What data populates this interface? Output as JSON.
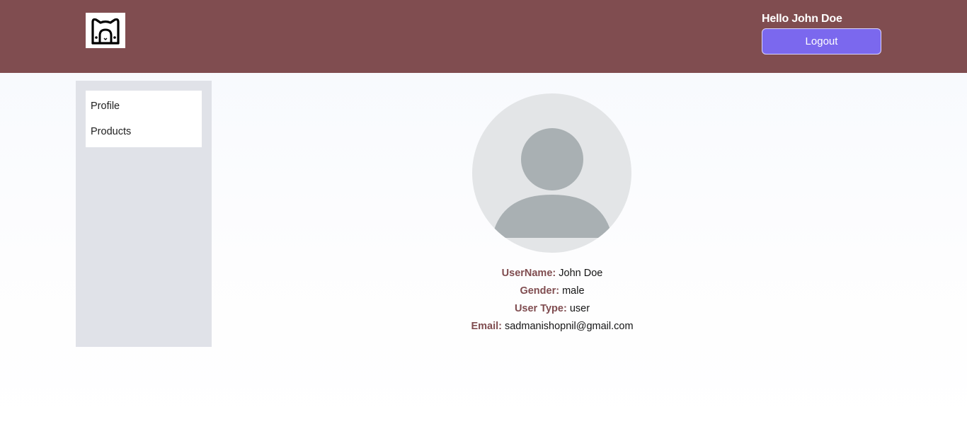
{
  "header": {
    "greeting": "Hello John Doe",
    "logout_label": "Logout",
    "logo_icon": "cat-face-icon",
    "background_color": "#804d50",
    "button_color": "#7b68ee"
  },
  "sidebar": {
    "items": [
      {
        "label": "Profile"
      },
      {
        "label": "Products"
      }
    ]
  },
  "profile": {
    "avatar_icon": "user-placeholder-icon",
    "fields": [
      {
        "label": "UserName:",
        "value": "John Doe"
      },
      {
        "label": "Gender:",
        "value": "male"
      },
      {
        "label": "User Type:",
        "value": "user"
      },
      {
        "label": "Email:",
        "value": "sadmanishopnil@gmail.com"
      }
    ]
  }
}
